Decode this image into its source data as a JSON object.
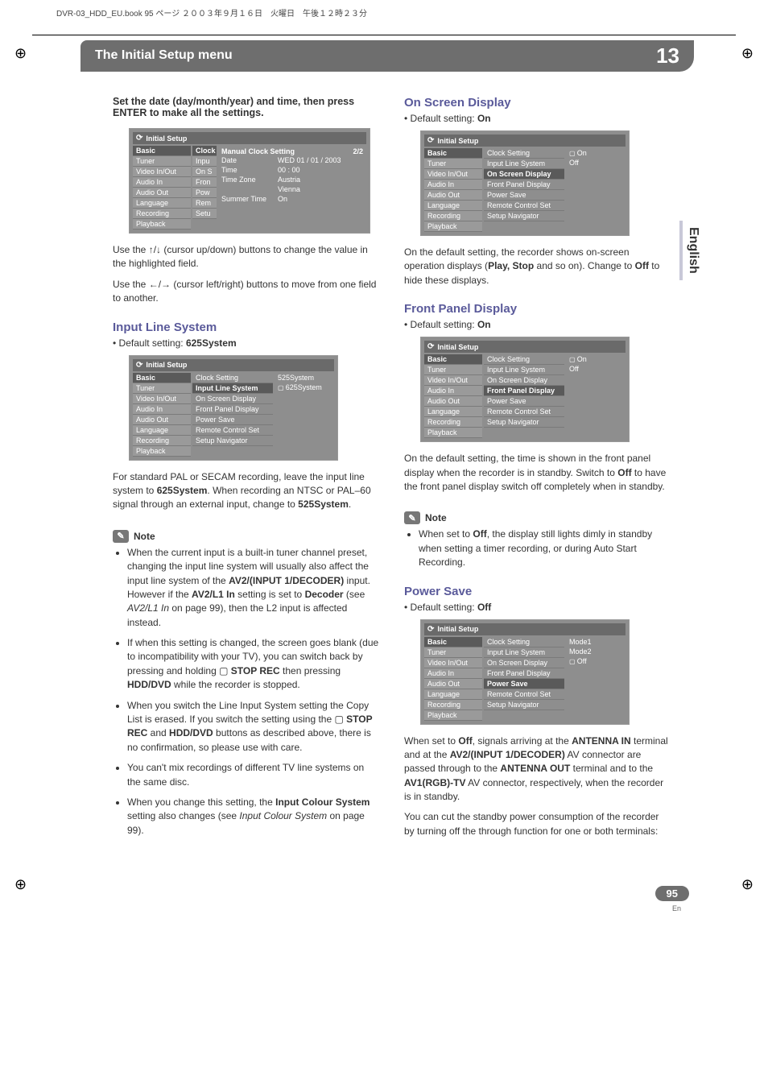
{
  "header_strip": "DVR-03_HDD_EU.book 95 ページ ２００３年９月１６日　火曜日　午後１２時２３分",
  "chapter": {
    "title": "The Initial Setup menu",
    "number": "13"
  },
  "side_tab": "English",
  "left": {
    "lead": "Set the date (day/month/year) and time, then press ENTER to make all the settings.",
    "osd_clock": {
      "title": "Initial Setup",
      "nav": [
        "Basic",
        "Tuner",
        "Video In/Out",
        "Audio In",
        "Audio Out",
        "Language",
        "Recording",
        "Playback"
      ],
      "col2": [
        "Clock",
        "Inpu",
        "On S",
        "Fron",
        "Pow",
        "Rem",
        "Setu"
      ],
      "panel_title": "Manual Clock Setting",
      "page_ind": "2/2",
      "rows": [
        {
          "k": "Date",
          "v": "WED  01 / 01 / 2003"
        },
        {
          "k": "Time",
          "v": "00 : 00"
        },
        {
          "k": "Time Zone",
          "v": "Austria"
        },
        {
          "k": "",
          "v": "Vienna"
        },
        {
          "k": "Summer Time",
          "v": "On"
        }
      ]
    },
    "p1": "Use the ↑/↓ (cursor up/down) buttons to change the value in the highlighted field.",
    "p2": "Use the ←/→ (cursor left/right) buttons to move from one field to another.",
    "sec1_title": "Input Line System",
    "sec1_default_label": "Default setting:",
    "sec1_default_value": "625System",
    "osd_ils": {
      "title": "Initial Setup",
      "nav": [
        "Basic",
        "Tuner",
        "Video In/Out",
        "Audio In",
        "Audio Out",
        "Language",
        "Recording",
        "Playback"
      ],
      "mid": [
        "Clock Setting",
        "Input Line System",
        "On Screen Display",
        "Front Panel Display",
        "Power Save",
        "Remote Control Set",
        "Setup Navigator"
      ],
      "right": [
        "525System",
        "625System"
      ],
      "mid_hl": 1,
      "right_sel": 1
    },
    "p3a": "For standard PAL or SECAM recording, leave the input line system to ",
    "p3b": "625System",
    "p3c": ". When recording an NTSC or PAL–60 signal through an external input, change to ",
    "p3d": "525System",
    "p3e": ".",
    "note_label": "Note",
    "notes": [
      {
        "t": "When the current input is a built-in tuner channel preset, changing the input line system will usually also affect the input line system of the ",
        "b1": "AV2/(INPUT 1/DECODER)",
        "t2": " input. However if the ",
        "b2": "AV2/L1 In",
        "t3": " setting is set to ",
        "b3": "Decoder",
        "t4": " (see ",
        "i": "AV2/L1 In",
        "t5": " on page 99), then the L2 input is affected instead."
      },
      {
        "t": "If when this setting is changed, the screen goes blank (due to incompatibility with your TV), you can switch back by pressing and holding ▢ ",
        "b1": "STOP REC",
        "t2": " then pressing ",
        "b2": "HDD/DVD",
        "t3": " while the recorder is stopped."
      },
      {
        "t": "When you switch the Line Input System setting the Copy List is erased. If you switch the setting using the ▢ ",
        "b1": "STOP REC",
        "t2": " and ",
        "b2": "HDD/DVD",
        "t3": " buttons as described above, there is no confirmation, so please use with care."
      },
      {
        "t": "You can't mix recordings of different TV line systems on the same disc."
      },
      {
        "t": "When you change this setting, the ",
        "b1": "Input Colour System",
        "t2": " setting also changes (see ",
        "i": "Input Colour System",
        "t3": " on page 99)."
      }
    ]
  },
  "right": {
    "sec1_title": "On Screen Display",
    "default_label": "Default setting:",
    "on": "On",
    "off": "Off",
    "osd_osd": {
      "title": "Initial Setup",
      "nav": [
        "Basic",
        "Tuner",
        "Video In/Out",
        "Audio In",
        "Audio Out",
        "Language",
        "Recording",
        "Playback"
      ],
      "mid": [
        "Clock Setting",
        "Input Line System",
        "On Screen Display",
        "Front Panel Display",
        "Power Save",
        "Remote Control Set",
        "Setup Navigator"
      ],
      "right": [
        "On",
        "Off"
      ],
      "mid_hl": 2,
      "right_sel": 0
    },
    "p1a": "On the default setting, the recorder shows on-screen operation displays (",
    "p1b": "Play, Stop",
    "p1c": " and so on). Change to ",
    "p1d": "Off",
    "p1e": " to hide these displays.",
    "sec2_title": "Front Panel Display",
    "osd_fpd": {
      "title": "Initial Setup",
      "nav": [
        "Basic",
        "Tuner",
        "Video In/Out",
        "Audio In",
        "Audio Out",
        "Language",
        "Recording",
        "Playback"
      ],
      "mid": [
        "Clock Setting",
        "Input Line System",
        "On Screen Display",
        "Front Panel Display",
        "Power Save",
        "Remote Control Set",
        "Setup Navigator"
      ],
      "right": [
        "On",
        "Off"
      ],
      "mid_hl": 3,
      "right_sel": 0
    },
    "p2": "On the default setting, the time is shown in the front panel display when the recorder is in standby. Switch to ",
    "p2b": "Off",
    "p2c": " to have the front panel display switch off completely when in standby.",
    "note_label": "Note",
    "note1a": "When set to ",
    "note1b": "Off",
    "note1c": ", the display still lights dimly in standby when setting a timer recording, or during Auto Start Recording.",
    "sec3_title": "Power Save",
    "osd_ps": {
      "title": "Initial Setup",
      "nav": [
        "Basic",
        "Tuner",
        "Video In/Out",
        "Audio In",
        "Audio Out",
        "Language",
        "Recording",
        "Playback"
      ],
      "mid": [
        "Clock Setting",
        "Input Line System",
        "On Screen Display",
        "Front Panel Display",
        "Power Save",
        "Remote Control Set",
        "Setup Navigator"
      ],
      "right": [
        "Mode1",
        "Mode2",
        "Off"
      ],
      "mid_hl": 4,
      "right_sel": 2
    },
    "p3a": "When set to ",
    "p3b": "Off",
    "p3c": ", signals arriving at the ",
    "p3d": "ANTENNA IN",
    "p3e": " terminal and at the ",
    "p3f": "AV2/(INPUT 1/DECODER)",
    "p3g": " AV connector are passed through to the ",
    "p3h": "ANTENNA OUT",
    "p3i": " terminal and to the ",
    "p3j": "AV1(RGB)-TV",
    "p3k": " AV connector, respectively, when the recorder is in standby.",
    "p4": "You can cut the standby power consumption of the recorder by turning off the through function for one or both terminals:"
  },
  "page_number": "95",
  "page_suffix": "En"
}
